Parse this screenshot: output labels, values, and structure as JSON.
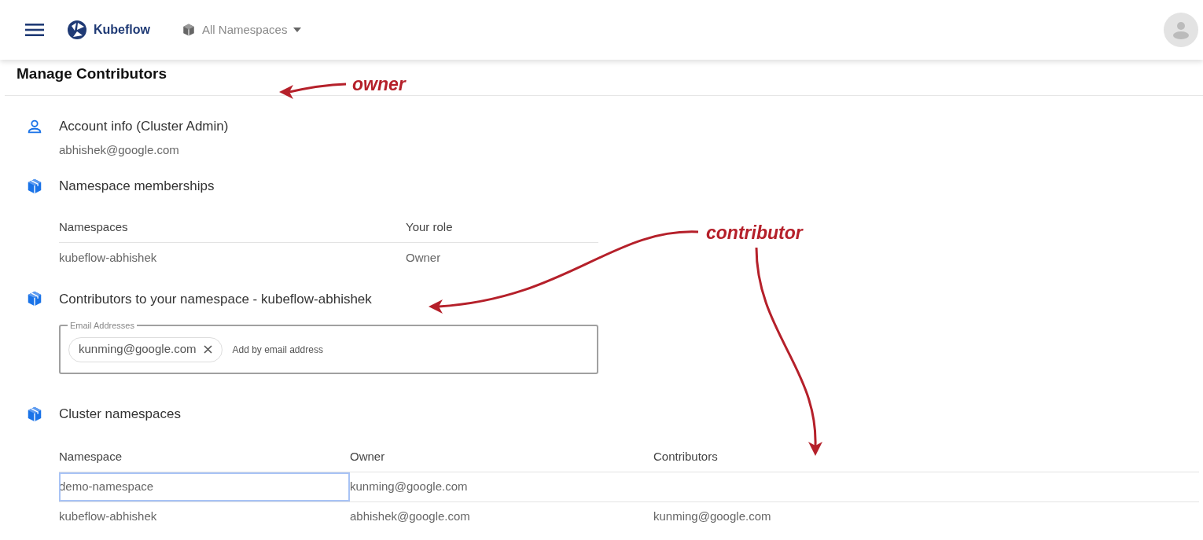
{
  "header": {
    "brand": "Kubeflow",
    "namespace_selector": "All Namespaces"
  },
  "page_title": "Manage Contributors",
  "account_info": {
    "title": "Account info  (Cluster Admin)",
    "email": "abhishek@google.com"
  },
  "namespace_memberships": {
    "title": "Namespace memberships",
    "columns": [
      "Namespaces",
      "Your role"
    ],
    "rows": [
      [
        "kubeflow-abhishek",
        "Owner"
      ]
    ]
  },
  "contributors": {
    "title": "Contributors to your namespace - kubeflow-abhishek",
    "field_label": "Email Addresses",
    "chips": [
      {
        "label": "kunming@google.com"
      }
    ],
    "placeholder": "Add by email address"
  },
  "cluster_namespaces": {
    "title": "Cluster namespaces",
    "columns": [
      "Namespace",
      "Owner",
      "Contributors"
    ],
    "rows": [
      {
        "namespace": "demo-namespace",
        "owner": "kunming@google.com",
        "focused": true
      },
      {
        "namespace": "kubeflow-abhishek",
        "owner": "abhishek@google.com",
        "contributors": "kunming@google.com",
        "focused": false
      }
    ]
  },
  "annotations": [
    {
      "text": "owner"
    },
    {
      "text": "contributor"
    }
  ]
}
